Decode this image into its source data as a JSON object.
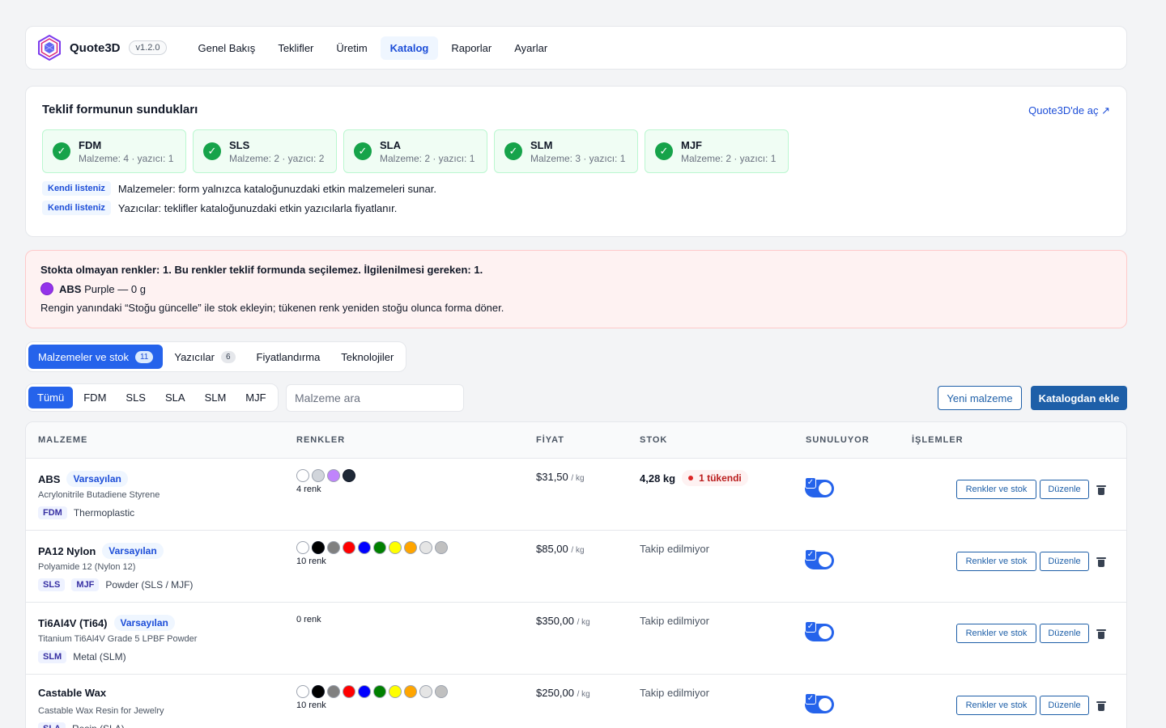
{
  "app": {
    "name": "Quote3D",
    "version": "v1.2.0"
  },
  "nav": [
    {
      "label": "Genel Bakış",
      "active": false
    },
    {
      "label": "Teklifler",
      "active": false
    },
    {
      "label": "Üretim",
      "active": false
    },
    {
      "label": "Katalog",
      "active": true
    },
    {
      "label": "Raporlar",
      "active": false
    },
    {
      "label": "Ayarlar",
      "active": false
    }
  ],
  "offering": {
    "title": "Teklif formunun sundukları",
    "link": "Quote3D'de aç ↗",
    "technologies": [
      {
        "name": "FDM",
        "sub": "Malzeme: 4 · yazıcı: 1"
      },
      {
        "name": "SLS",
        "sub": "Malzeme: 2 · yazıcı: 2"
      },
      {
        "name": "SLA",
        "sub": "Malzeme: 2 · yazıcı: 1"
      },
      {
        "name": "SLM",
        "sub": "Malzeme: 3 · yazıcı: 1"
      },
      {
        "name": "MJF",
        "sub": "Malzeme: 2 · yazıcı: 1"
      }
    ],
    "notes": [
      {
        "badge": "Kendi listeniz",
        "text": "Malzemeler: form yalnızca kataloğunuzdaki etkin malzemeleri sunar."
      },
      {
        "badge": "Kendi listeniz",
        "text": "Yazıcılar: teklifler kataloğunuzdaki etkin yazıcılarla fiyatlanır."
      }
    ]
  },
  "alert": {
    "title": "Stokta olmayan renkler: 1. Bu renkler teklif formunda seçilemez. İlgilenilmesi gereken: 1.",
    "item_material": "ABS",
    "item_detail": "Purple — 0 g",
    "item_color": "#9333ea",
    "note": "Rengin yanındaki “Stoğu güncelle” ile stok ekleyin; tükenen renk yeniden stoğu olunca forma döner."
  },
  "tabs": [
    {
      "label": "Malzemeler ve stok",
      "count": "11",
      "active": true
    },
    {
      "label": "Yazıcılar",
      "count": "6",
      "active": false
    },
    {
      "label": "Fiyatlandırma",
      "count": null,
      "active": false
    },
    {
      "label": "Teknolojiler",
      "count": null,
      "active": false
    }
  ],
  "filters": [
    {
      "label": "Tümü",
      "active": true
    },
    {
      "label": "FDM",
      "active": false
    },
    {
      "label": "SLS",
      "active": false
    },
    {
      "label": "SLA",
      "active": false
    },
    {
      "label": "SLM",
      "active": false
    },
    {
      "label": "MJF",
      "active": false
    }
  ],
  "search": {
    "placeholder": "Malzeme ara",
    "value": ""
  },
  "buttons": {
    "new_material": "Yeni malzeme",
    "add_from_catalog": "Katalogdan ekle"
  },
  "table": {
    "headers": [
      "MALZEME",
      "RENKLER",
      "FİYAT",
      "STOK",
      "SUNULUYOR",
      "İŞLEMLER"
    ],
    "actions": {
      "colors_stock": "Renkler ve stok",
      "edit": "Düzenle"
    },
    "rows": [
      {
        "name": "ABS",
        "badge": "Varsayılan",
        "desc": "Acrylonitrile Butadiene Styrene",
        "tags": [
          "FDM"
        ],
        "category": "Thermoplastic",
        "colors": [
          "#ffffff",
          "#d1d5db",
          "#c084fc",
          "#1f2937"
        ],
        "color_count": "4 renk",
        "price": "$31,50",
        "unit": "/ kg",
        "stock": "4,28 kg",
        "stock_tracked": true,
        "sold_out": "1 tükendi",
        "offered": true
      },
      {
        "name": "PA12 Nylon",
        "badge": "Varsayılan",
        "desc": "Polyamide 12 (Nylon 12)",
        "tags": [
          "SLS",
          "MJF"
        ],
        "category": "Powder (SLS / MJF)",
        "colors": [
          "#ffffff",
          "#000000",
          "#808080",
          "#ff0000",
          "#0000ff",
          "#008000",
          "#ffff00",
          "#ffa500",
          "#e5e5e5",
          "#c0c0c0"
        ],
        "color_count": "10 renk",
        "price": "$85,00",
        "unit": "/ kg",
        "stock": "Takip edilmiyor",
        "stock_tracked": false,
        "sold_out": null,
        "offered": true
      },
      {
        "name": "Ti6Al4V (Ti64)",
        "badge": "Varsayılan",
        "desc": "Titanium Ti6Al4V Grade 5 LPBF Powder",
        "tags": [
          "SLM"
        ],
        "category": "Metal (SLM)",
        "colors": [],
        "color_count": "0 renk",
        "price": "$350,00",
        "unit": "/ kg",
        "stock": "Takip edilmiyor",
        "stock_tracked": false,
        "sold_out": null,
        "offered": true
      },
      {
        "name": "Castable Wax",
        "badge": null,
        "desc": "Castable Wax Resin for Jewelry",
        "tags": [
          "SLA"
        ],
        "category": "Resin (SLA)",
        "colors": [
          "#ffffff",
          "#000000",
          "#808080",
          "#ff0000",
          "#0000ff",
          "#008000",
          "#ffff00",
          "#ffa500",
          "#e5e5e5",
          "#c0c0c0"
        ],
        "color_count": "10 renk",
        "price": "$250,00",
        "unit": "/ kg",
        "stock": "Takip edilmiyor",
        "stock_tracked": false,
        "sold_out": null,
        "offered": true
      }
    ]
  }
}
